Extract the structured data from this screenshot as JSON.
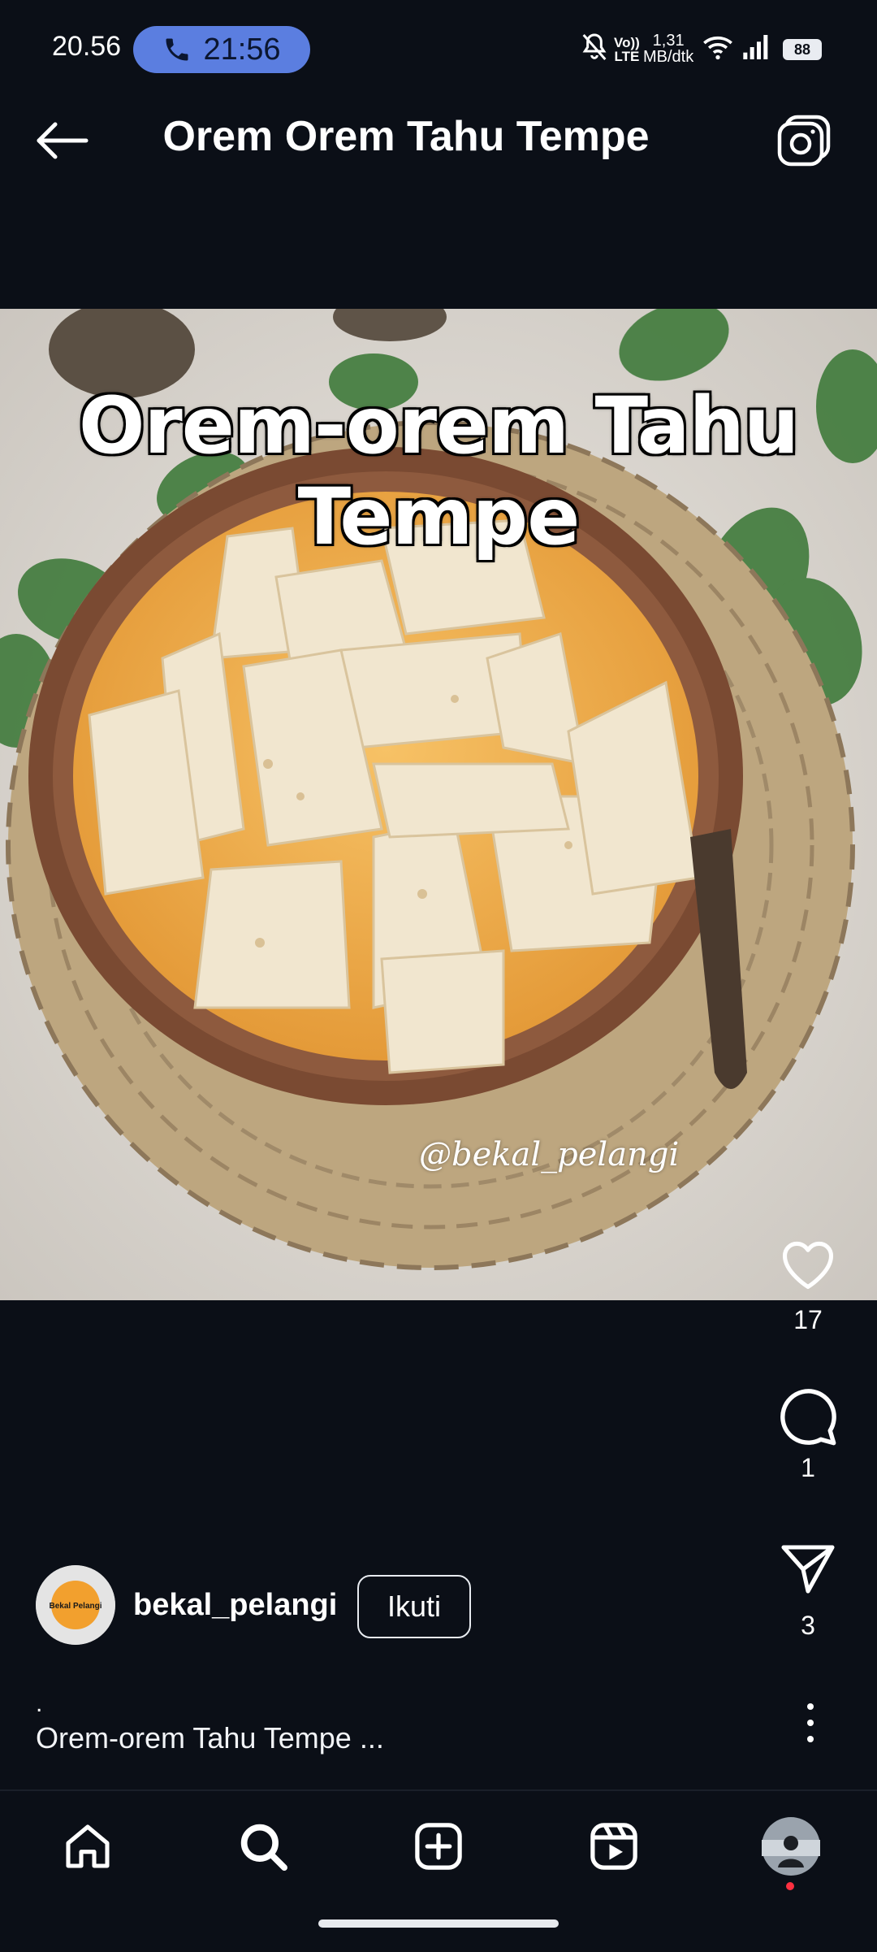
{
  "status_bar": {
    "time": "20.56",
    "call_timer": "21:56",
    "network_speed_value": "1,31",
    "network_speed_unit": "MB/dtk",
    "volte_label_1": "Vo))",
    "volte_label_2": "LTE",
    "battery": "88"
  },
  "header": {
    "title": "Orem Orem Tahu Tempe"
  },
  "post": {
    "image_overlay_title": "Orem-orem Tahu Tempe",
    "image_watermark": "@bekal_pelangi",
    "likes": "17",
    "comments": "1",
    "shares": "3",
    "author": {
      "username": "bekal_pelangi",
      "avatar_text": "Bekal Pelangi",
      "follow_label": "Ikuti"
    },
    "caption_dot": ".",
    "caption": "Orem-orem Tahu Tempe ..."
  },
  "colors": {
    "background": "#0b0f17",
    "call_pill": "#5b7ee0",
    "text": "#ffffff",
    "notification_dot": "#ff3040"
  },
  "bottom_nav": {
    "items": [
      "home-icon",
      "search-icon",
      "create-icon",
      "reels-icon",
      "profile-avatar"
    ]
  }
}
